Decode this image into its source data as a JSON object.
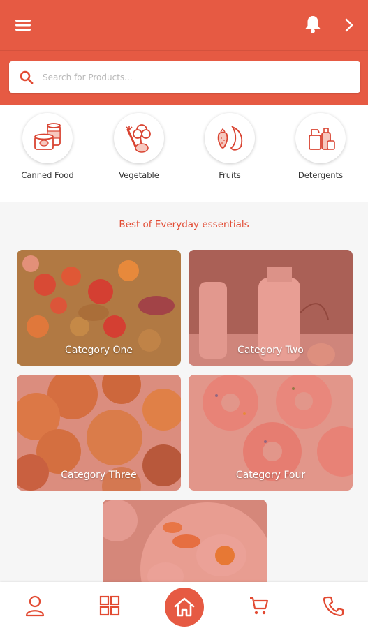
{
  "search": {
    "placeholder": "Search for Products..."
  },
  "categories": [
    {
      "label": "Canned Food",
      "icon": "canned-food-icon"
    },
    {
      "label": "Vegetable",
      "icon": "vegetable-icon"
    },
    {
      "label": "Fruits",
      "icon": "fruits-icon"
    },
    {
      "label": "Detergents",
      "icon": "detergents-icon"
    }
  ],
  "section": {
    "title": "Best of Everyday essentials"
  },
  "tiles": [
    {
      "label": "Category One"
    },
    {
      "label": "Category Two"
    },
    {
      "label": "Category Three"
    },
    {
      "label": "Category Four"
    },
    {
      "label": ""
    }
  ],
  "bottom_nav": [
    "profile-icon",
    "grid-icon",
    "home-icon",
    "cart-icon",
    "phone-icon"
  ],
  "colors": {
    "primary": "#e65a43",
    "accent_text": "#e24a32"
  }
}
